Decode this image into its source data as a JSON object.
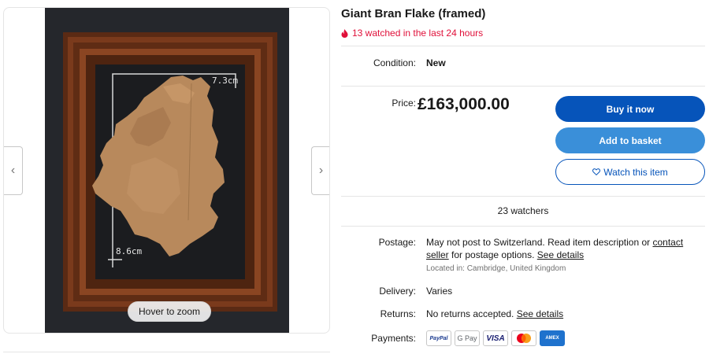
{
  "gallery": {
    "prev_arrow": "‹",
    "next_arrow": "›",
    "zoom_hint": "Hover to zoom",
    "photo_annotations": {
      "width_label": "7.3cm",
      "height_label": "8.6cm"
    }
  },
  "listing": {
    "title": "Giant Bran Flake (framed)",
    "watched_recent": "13 watched in the last 24 hours"
  },
  "condition": {
    "label": "Condition:",
    "value": "New"
  },
  "price": {
    "label": "Price:",
    "value": "£163,000.00"
  },
  "actions": {
    "buy_now": "Buy it now",
    "add_to_basket": "Add to basket",
    "watch": "Watch this item"
  },
  "watchers": "23 watchers",
  "postage": {
    "label": "Postage:",
    "text_before": "May not post to Switzerland. Read item description or ",
    "contact_link": "contact seller",
    "text_middle": " for postage options. ",
    "details_link": "See details",
    "location": "Located in: Cambridge, United Kingdom"
  },
  "delivery": {
    "label": "Delivery:",
    "value": "Varies"
  },
  "returns": {
    "label": "Returns:",
    "value": "No returns accepted. ",
    "details_link": "See details"
  },
  "payments": {
    "label": "Payments:",
    "methods": [
      "PayPal",
      "G Pay",
      "VISA",
      "Mastercard",
      "AMEX"
    ]
  },
  "colors": {
    "primary_blue": "#0654ba",
    "secondary_blue": "#3a8fd9",
    "urgency_red": "#e0103a"
  }
}
